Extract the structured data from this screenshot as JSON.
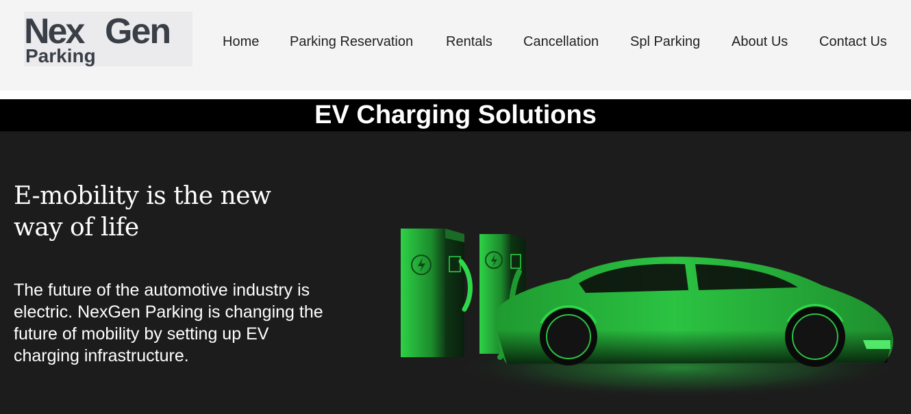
{
  "brand": {
    "logo_line1_a": "Nex",
    "logo_line1_b": "Gen",
    "logo_line2": "Parking"
  },
  "nav": {
    "items": [
      {
        "label": "Home"
      },
      {
        "label": "Parking Reservation"
      },
      {
        "label": "Rentals"
      },
      {
        "label": "Cancellation"
      },
      {
        "label": "Spl Parking"
      },
      {
        "label": "About Us"
      },
      {
        "label": "Contact Us"
      }
    ]
  },
  "banner": {
    "title": "EV Charging Solutions"
  },
  "hero": {
    "heading": "E-mobility is the new way of life",
    "body": "The future of the automotive industry is electric. NexGen Parking is changing the future of mobility by setting up EV charging infrastructure.",
    "image_icons": [
      "ev-charger-icon",
      "ev-charger-icon",
      "electric-car-icon"
    ]
  },
  "colors": {
    "header_bg": "#f4f4f5",
    "banner_bg": "#000000",
    "hero_bg": "#1c1c1c",
    "accent_green": "#2fd84a",
    "logo_dark": "#3a3f47"
  }
}
